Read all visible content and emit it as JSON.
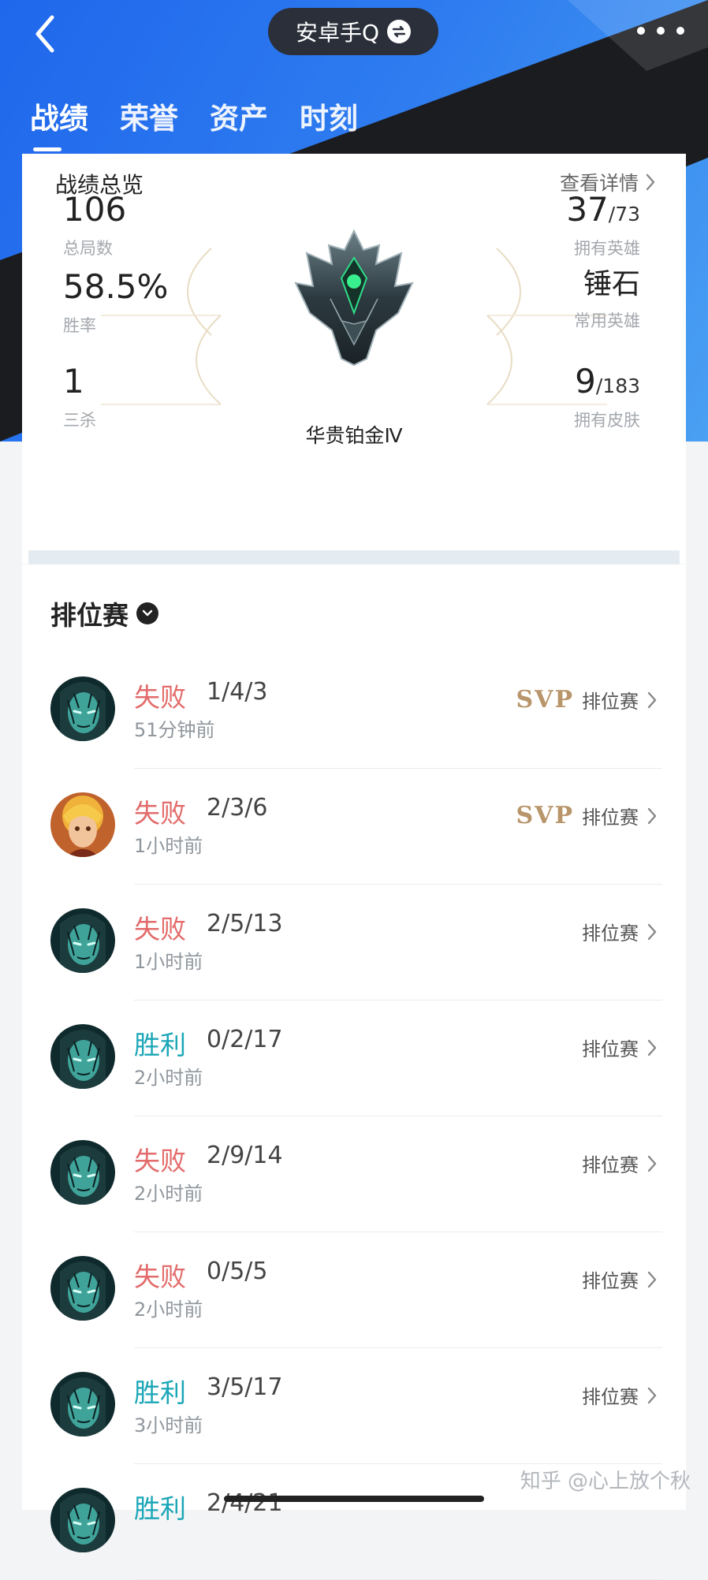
{
  "header": {
    "title": "安卓手Q",
    "tabs": [
      "战绩",
      "荣誉",
      "资产",
      "时刻"
    ],
    "active_tab": 0
  },
  "summary": {
    "title": "战绩总览",
    "more": "查看详情",
    "left": [
      {
        "value": "106",
        "label": "总局数"
      },
      {
        "value": "58.5%",
        "label": "胜率"
      },
      {
        "value": "1",
        "label": "三杀"
      }
    ],
    "right": [
      {
        "value": "37",
        "total": "/73",
        "label": "拥有英雄"
      },
      {
        "value": "锤石",
        "total": "",
        "label": "常用英雄"
      },
      {
        "value": "9",
        "total": "/183",
        "label": "拥有皮肤"
      }
    ],
    "rank": "华贵铂金Ⅳ"
  },
  "matches": {
    "title": "排位赛",
    "rows": [
      {
        "result": "失败",
        "type": "lose",
        "kda": "1/4/3",
        "ago": "51分钟前",
        "svp": "SVP",
        "mode": "排位赛",
        "hero": "thresh"
      },
      {
        "result": "失败",
        "type": "lose",
        "kda": "2/3/6",
        "ago": "1小时前",
        "svp": "SVP",
        "mode": "排位赛",
        "hero": "lux"
      },
      {
        "result": "失败",
        "type": "lose",
        "kda": "2/5/13",
        "ago": "1小时前",
        "svp": "",
        "mode": "排位赛",
        "hero": "thresh"
      },
      {
        "result": "胜利",
        "type": "win",
        "kda": "0/2/17",
        "ago": "2小时前",
        "svp": "",
        "mode": "排位赛",
        "hero": "thresh"
      },
      {
        "result": "失败",
        "type": "lose",
        "kda": "2/9/14",
        "ago": "2小时前",
        "svp": "",
        "mode": "排位赛",
        "hero": "thresh"
      },
      {
        "result": "失败",
        "type": "lose",
        "kda": "0/5/5",
        "ago": "2小时前",
        "svp": "",
        "mode": "排位赛",
        "hero": "thresh"
      },
      {
        "result": "胜利",
        "type": "win",
        "kda": "3/5/17",
        "ago": "3小时前",
        "svp": "",
        "mode": "排位赛",
        "hero": "thresh"
      },
      {
        "result": "胜利",
        "type": "win",
        "kda": "2/4/21",
        "ago": "",
        "svp": "",
        "mode": "",
        "hero": "thresh"
      }
    ]
  },
  "watermark": "知乎 @心上放个秋",
  "colors": {
    "lose": "#e36b6b",
    "win": "#1aa6b7",
    "svp": "#b8956a",
    "accent": "#1f67ec"
  }
}
